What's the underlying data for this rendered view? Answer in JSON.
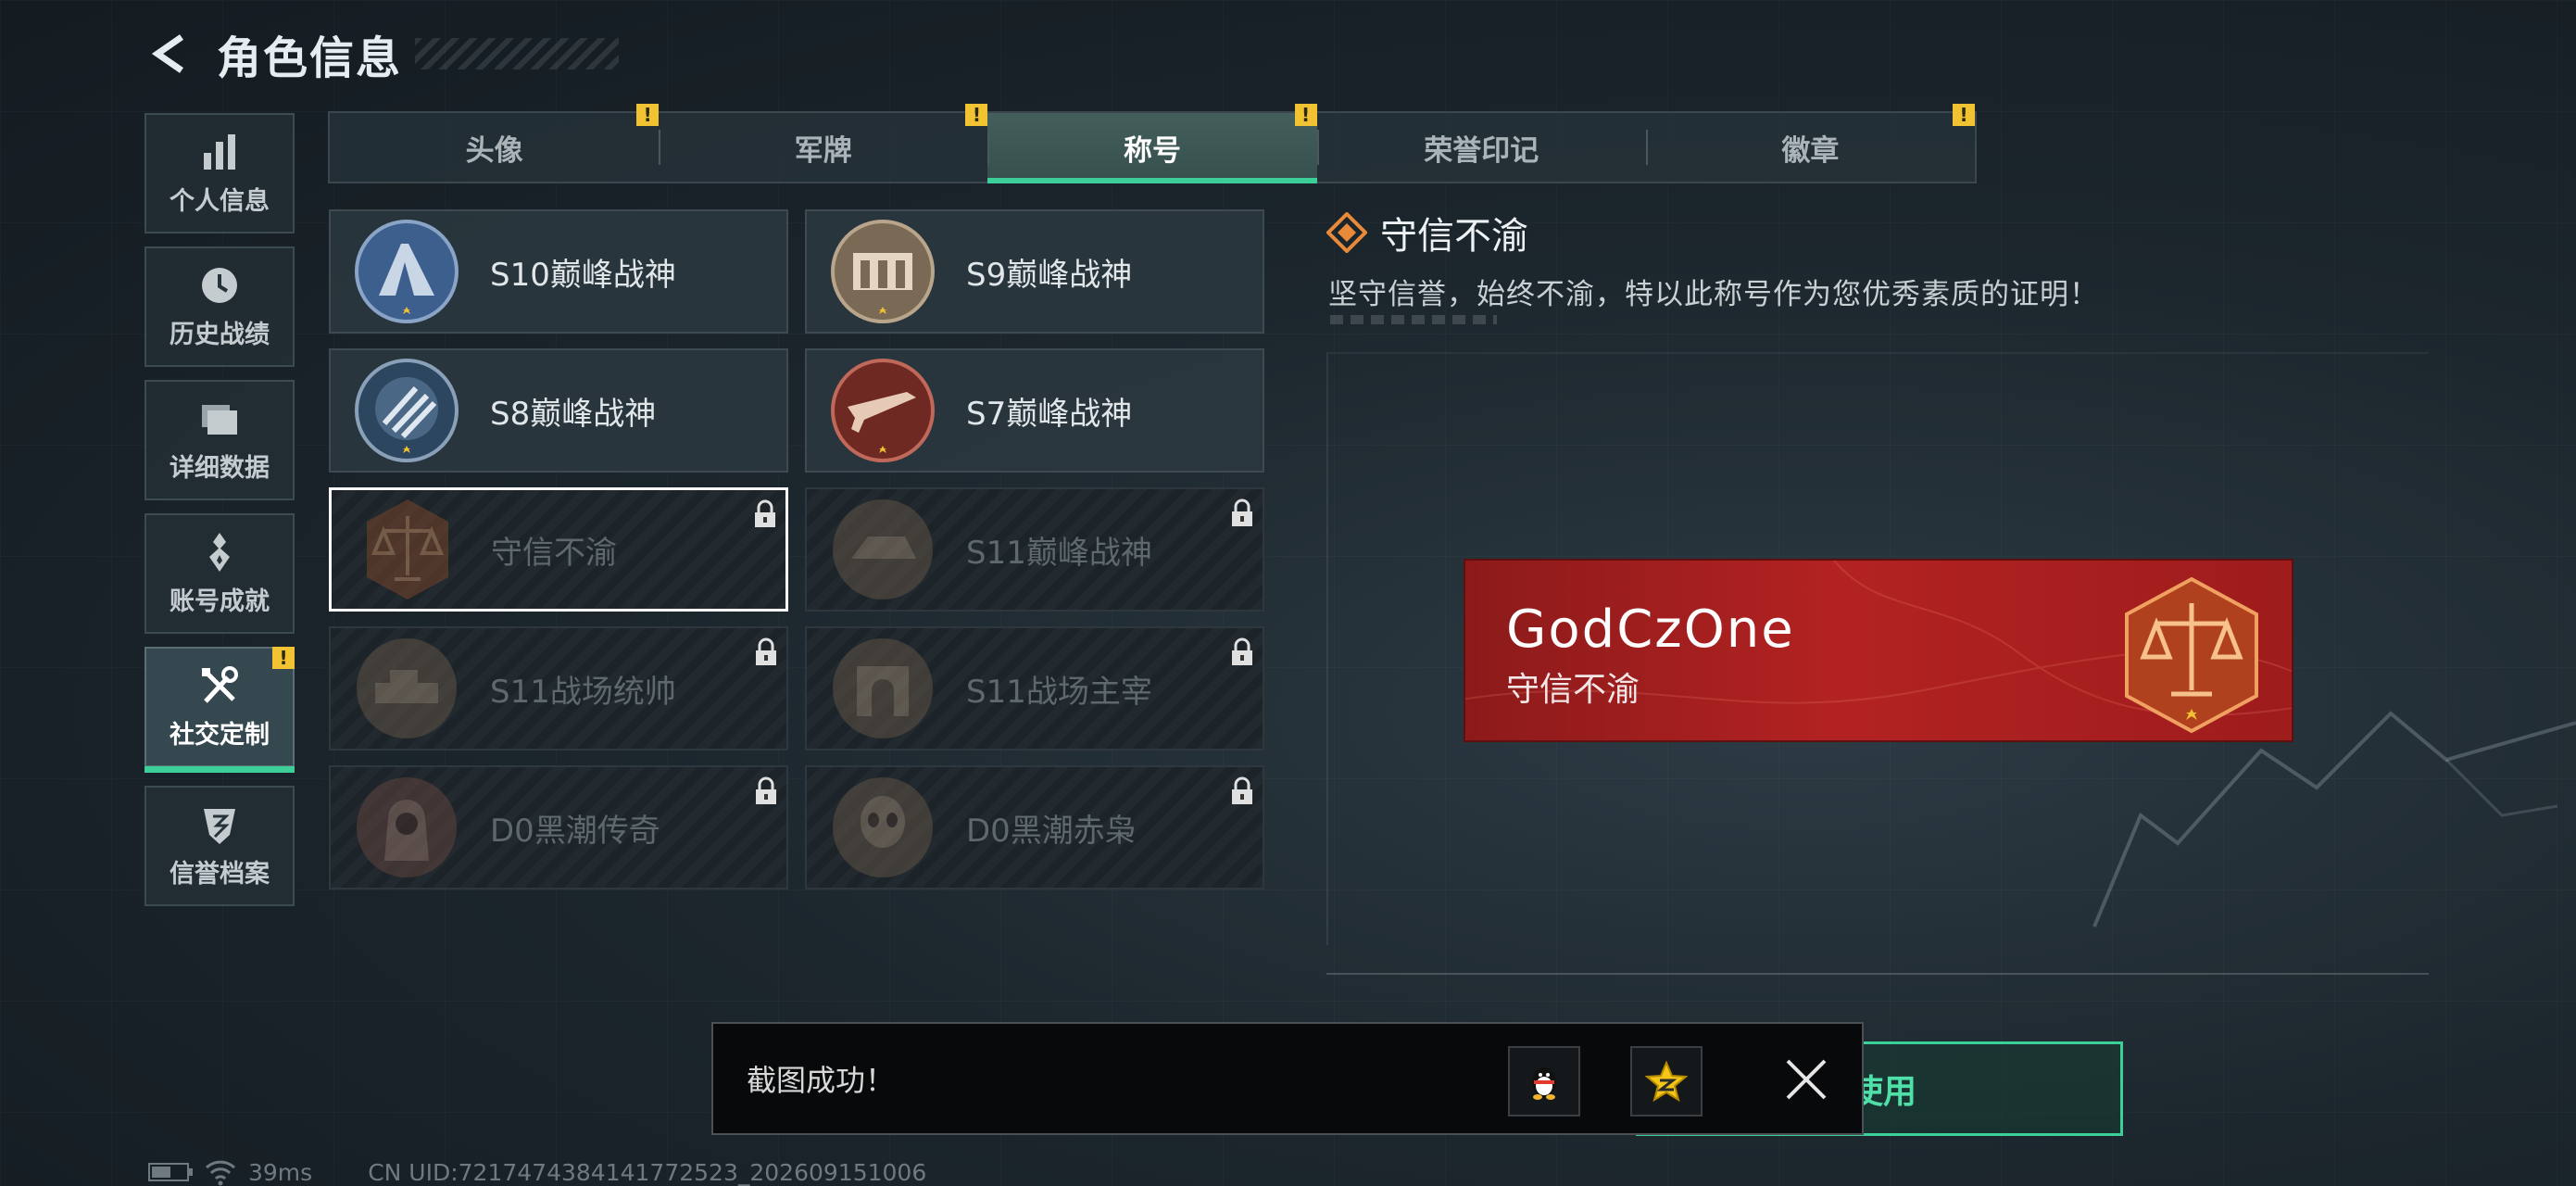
{
  "header": {
    "title": "角色信息"
  },
  "sidebar": {
    "items": [
      {
        "label": "个人信息",
        "icon": "bar-chart-icon"
      },
      {
        "label": "历史战绩",
        "icon": "clock-icon"
      },
      {
        "label": "详细数据",
        "icon": "folder-icon"
      },
      {
        "label": "账号成就",
        "icon": "medal-icon"
      },
      {
        "label": "社交定制",
        "icon": "tools-icon",
        "active": true,
        "badge": "!"
      },
      {
        "label": "信誉档案",
        "icon": "shield-icon"
      }
    ]
  },
  "tabs": [
    {
      "label": "头像",
      "badge": "!"
    },
    {
      "label": "军牌",
      "badge": "!"
    },
    {
      "label": "称号",
      "badge": "!",
      "active": true
    },
    {
      "label": "荣誉印记"
    },
    {
      "label": "徽章",
      "badge": "!"
    }
  ],
  "titles": [
    {
      "label": "S10巅峰战神",
      "locked": false
    },
    {
      "label": "S9巅峰战神",
      "locked": false
    },
    {
      "label": "S8巅峰战神",
      "locked": false
    },
    {
      "label": "S7巅峰战神",
      "locked": false
    },
    {
      "label": "守信不渝",
      "locked": true,
      "selected": true
    },
    {
      "label": "S11巅峰战神",
      "locked": true
    },
    {
      "label": "S11战场统帅",
      "locked": true
    },
    {
      "label": "S11战场主宰",
      "locked": true
    },
    {
      "label": "D0黑潮传奇",
      "locked": true
    },
    {
      "label": "D0黑潮赤枭",
      "locked": true
    }
  ],
  "detail": {
    "title": "守信不渝",
    "description": "坚守信誉，始终不渝，特以此称号作为您优秀素质的证明！"
  },
  "banner": {
    "player_name": "GodCzOne",
    "title": "守信不渝"
  },
  "use_button": {
    "label": "使用"
  },
  "toast": {
    "message": "截图成功！"
  },
  "status": {
    "ping": "39ms",
    "uid": "CN UID:7217474384141772523_202609151006"
  },
  "colors": {
    "accent": "#3ccf9a",
    "warning": "#f1c232",
    "banner_red": "#b32222"
  }
}
